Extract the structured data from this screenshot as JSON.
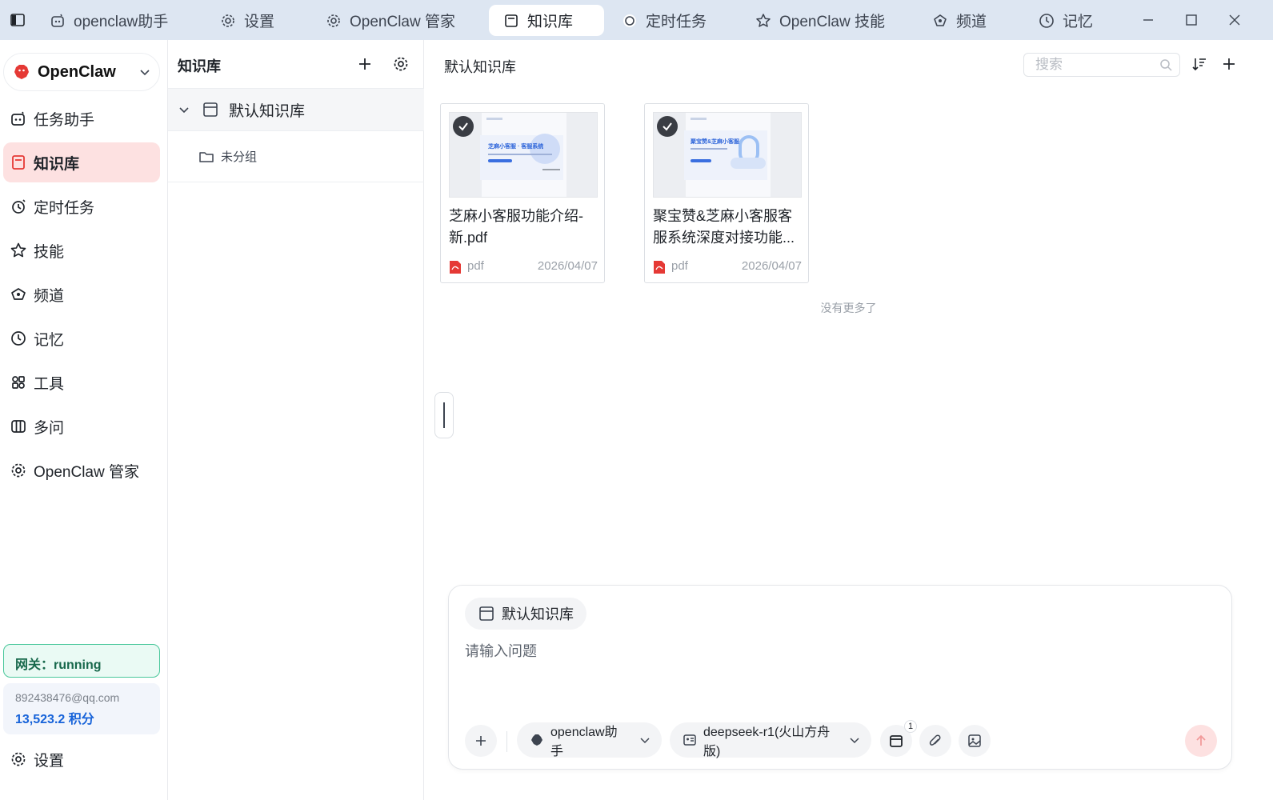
{
  "titlebar": {
    "tabs": [
      {
        "label": "openclaw助手",
        "icon": "bot-icon"
      },
      {
        "label": "设置",
        "icon": "gear-icon"
      },
      {
        "label": "OpenClaw 管家",
        "icon": "gear-icon"
      },
      {
        "label": "知识库",
        "icon": "book-icon",
        "active": true
      },
      {
        "label": "定时任务",
        "icon": "circle-icon"
      },
      {
        "label": "OpenClaw 技能",
        "icon": "star-icon"
      },
      {
        "label": "频道",
        "icon": "channel-icon"
      },
      {
        "label": "记忆",
        "icon": "clock-icon"
      }
    ]
  },
  "sidebar": {
    "brand": "OpenClaw",
    "items": [
      {
        "label": "任务助手",
        "icon": "bot-icon"
      },
      {
        "label": "知识库",
        "icon": "book-icon",
        "active": true
      },
      {
        "label": "定时任务",
        "icon": "timer-icon"
      },
      {
        "label": "技能",
        "icon": "star-icon"
      },
      {
        "label": "频道",
        "icon": "channel-icon"
      },
      {
        "label": "记忆",
        "icon": "clock-icon"
      },
      {
        "label": "工具",
        "icon": "tools-icon"
      },
      {
        "label": "多问",
        "icon": "columns-icon"
      },
      {
        "label": "OpenClaw 管家",
        "icon": "gear-icon"
      }
    ],
    "gateway": "网关：running",
    "account": {
      "email": "892438476@qq.com",
      "points": "13,523.2 积分"
    },
    "settings": "设置"
  },
  "kb_panel": {
    "title": "知识库",
    "tree": {
      "label": "默认知识库",
      "children": [
        {
          "label": "未分组"
        }
      ]
    }
  },
  "main": {
    "title": "默认知识库",
    "search_placeholder": "搜索",
    "files": [
      {
        "name": "芝麻小客服功能介绍-新.pdf",
        "type": "pdf",
        "date": "2026/04/07",
        "selected": true,
        "thumb_title": "芝麻小客服 · 客服系统"
      },
      {
        "name": "聚宝赞&芝麻小客服客服系统深度对接功能...",
        "type": "pdf",
        "date": "2026/04/07",
        "selected": true,
        "thumb_title": "聚宝赞&芝麻小客服"
      }
    ],
    "no_more": "没有更多了"
  },
  "chat": {
    "kb_chip": "默认知识库",
    "placeholder": "请输入问题",
    "agent": "openclaw助手",
    "model": "deepseek-r1(火山方舟版)",
    "kb_badge": "1"
  },
  "colors": {
    "accent": "#e53935",
    "titlebar_bg": "#dde6f2",
    "active_nav_bg": "#fde1e1",
    "gateway_border": "#48c79a",
    "points_color": "#1763d9"
  }
}
